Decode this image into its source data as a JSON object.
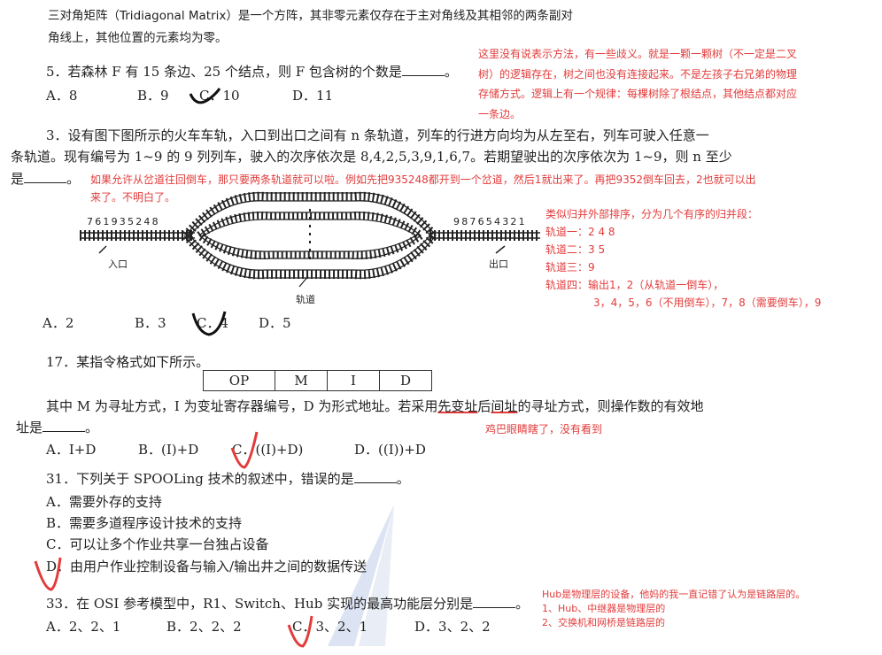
{
  "intro": {
    "line1": "三对角矩阵（Tridiagonal Matrix）是一个方阵，其非零元素仅存在于主对角线及其相邻的两条副对",
    "line2": "角线上，其他位置的元素均为零。"
  },
  "q5": {
    "stem": "5．若森林 F 有 15 条边、25 个结点，则 F 包含树的个数是",
    "end": "。",
    "options": [
      "A．8",
      "B．9",
      "C．10",
      "D．11"
    ]
  },
  "note_forest": {
    "lines": [
      "这里没有说表示方法，有一些歧义。就是一颗一颗树（不一定是二叉",
      "树）的逻辑存在，树之间也没有连接起来。不是左孩子右兄弟的物理",
      "存储方式。逻辑上有一个规律：每棵树除了根结点，其他结点都对应",
      "一条边。"
    ]
  },
  "q3": {
    "line1": "3．设有图下图所示的火车车轨，入口到出口之间有 n 条轨道，列车的行进方向均为从左至右，列车可驶入任意一",
    "line2": "条轨道。现有编号为 1~9 的 9 列列车，驶入的次序依次是 8,4,2,5,3,9,1,6,7。若期望驶出的次序依次为 1~9，则 n 至少",
    "line3_pre": "是",
    "line3_post": "。",
    "options": [
      "A．2",
      "B．3",
      "C．4",
      "D．5"
    ]
  },
  "note_train": {
    "line1": "如果允许从岔道往回倒车，那只要两条轨道就可以啦。例如先把935248都开到一个岔道，然后1就出来了。再把9352倒车回去，2也就可以出",
    "line2": "来了。不明白了。"
  },
  "diagram": {
    "left_seq": "761935248",
    "right_seq": "987654321",
    "entry_label": "入口",
    "exit_label": "出口",
    "track_label": "轨道"
  },
  "note_merge": {
    "lines": [
      "类似归并外部排序，分为几个有序的归并段：",
      "轨道一：2 4 8",
      "轨道二：3 5",
      "轨道三：9",
      "轨道四：输出1，2（从轨道一倒车），",
      "3，4，5，6（不用倒车），7，8（需要倒车），9"
    ]
  },
  "q17": {
    "stem": "17．某指令格式如下所示。",
    "fields": [
      "OP",
      "M",
      "I",
      "D"
    ],
    "line1_pre": "其中 M 为寻址方式，I 为变址寄存器编号，D 为形式地址。若采用",
    "hl1": "先变址",
    "mid": "后",
    "hl2": "间址",
    "line1_post": "的寻址方式，则操作数的有效地",
    "line2_pre": "址是",
    "line2_post": "。",
    "options": [
      "A．I+D",
      "B．(I)+D",
      "C．((I)+D)",
      "D．((I))+D"
    ]
  },
  "note_eye": {
    "text": "鸡巴眼睛瞎了，没有看到"
  },
  "q31": {
    "stem": "31．下列关于 SPOOLing 技术的叙述中，错误的是",
    "end": "。",
    "options": [
      "A．需要外存的支持",
      "B．需要多道程序设计技术的支持",
      "C．可以让多个作业共享一台独占设备",
      "D．由用户作业控制设备与输入/输出井之间的数据传送"
    ]
  },
  "q33": {
    "stem": "33．在 OSI 参考模型中，R1、Switch、Hub 实现的最高功能层分别是",
    "end": "。",
    "options": [
      "A．2、2、1",
      "B．2、2、2",
      "C．3、2、1",
      "D．3、2、2"
    ]
  },
  "note_hub": {
    "lines": [
      "Hub是物理层的设备，他妈的我一直记错了认为是链路层的。",
      "1、Hub、中继器是物理层的",
      "2、交换机和网桥是链路层的"
    ]
  },
  "colors": {
    "annotation": "#e33b3b",
    "ink": "#111111",
    "watermark": "#c9d4ea"
  }
}
